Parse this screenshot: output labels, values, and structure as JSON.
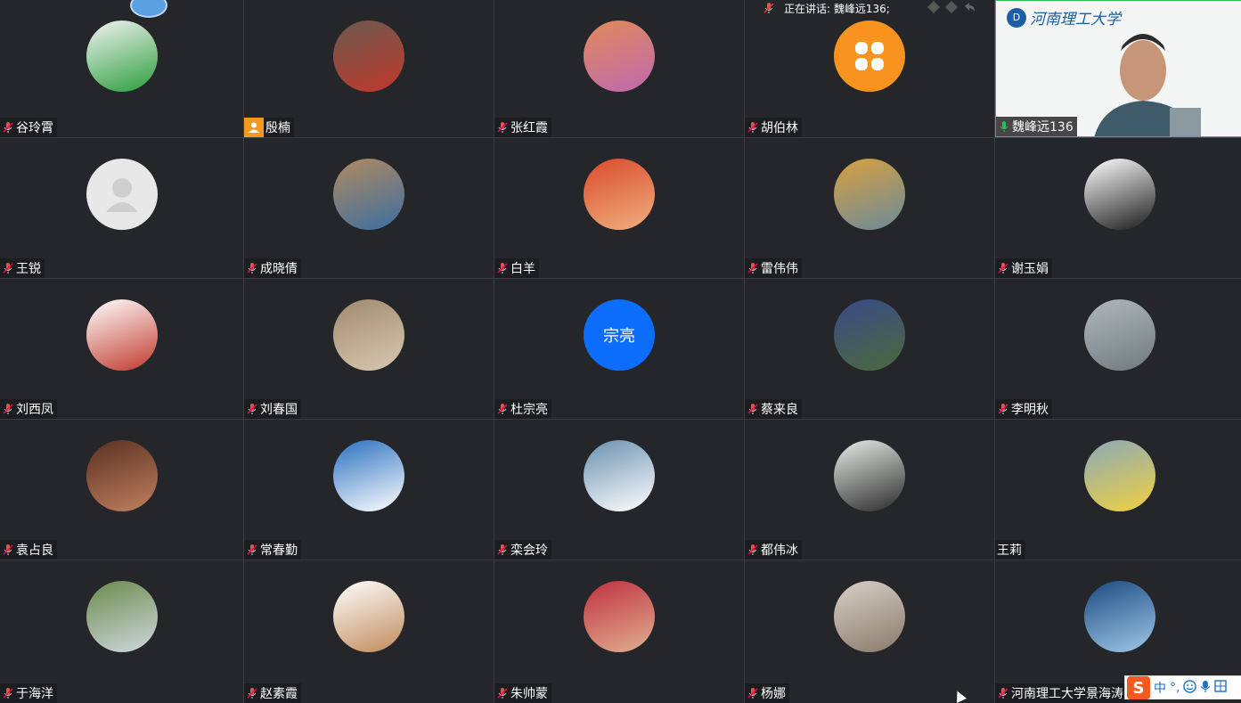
{
  "speaking": {
    "label": "正在讲话: 魏峰远136;"
  },
  "speaker": {
    "logo_text": "河南理工大学",
    "logo_mark": "D"
  },
  "ime": {
    "logo": "S",
    "mode": "中",
    "punct": "°,",
    "emoji": "☺",
    "mic": "🎤",
    "extra": "⊞"
  },
  "participants": [
    {
      "name": "谷玲霄",
      "avatar": "cartoon-girl",
      "colors": [
        "#f3f3f3",
        "#2a9d3a"
      ]
    },
    {
      "name": "殷楠",
      "avatar": "photo-boy-car",
      "colors": [
        "#6b5a50",
        "#c0392b"
      ],
      "badge": "person"
    },
    {
      "name": "张红霞",
      "avatar": "photo-sunset-flowers",
      "colors": [
        "#e08a5a",
        "#c069b0"
      ]
    },
    {
      "name": "胡伯林",
      "avatar": "orange-clover",
      "colors": [
        "#f7931e",
        "#ffffff"
      ]
    },
    {
      "name": "魏峰远136",
      "avatar": "speaker-video",
      "speaker": true
    },
    {
      "name": "王锐",
      "avatar": "default-user",
      "colors": [
        "#e8e8e8",
        "#cfcfcf"
      ]
    },
    {
      "name": "成晓倩",
      "avatar": "photo-girl-chair",
      "colors": [
        "#b08a60",
        "#3c6ea0"
      ]
    },
    {
      "name": "白羊",
      "avatar": "photo-hand-red",
      "colors": [
        "#d94a2a",
        "#f0b080"
      ]
    },
    {
      "name": "雷伟伟",
      "avatar": "photo-castle",
      "colors": [
        "#d9a040",
        "#6a8a9a"
      ]
    },
    {
      "name": "谢玉娟",
      "avatar": "drawing-girl",
      "colors": [
        "#ffffff",
        "#1a1a1a"
      ]
    },
    {
      "name": "刘西凤",
      "avatar": "toy-teapot",
      "colors": [
        "#ffffff",
        "#c0392b"
      ]
    },
    {
      "name": "刘春国",
      "avatar": "photo-rocks",
      "colors": [
        "#a08a70",
        "#d8c8b0"
      ]
    },
    {
      "name": "杜宗亮",
      "avatar": "text",
      "initials": "宗亮",
      "colors": [
        "#0d6efd",
        "#ffffff"
      ]
    },
    {
      "name": "蔡来良",
      "avatar": "photo-blue-flowers",
      "colors": [
        "#3a4a8a",
        "#4a6a3a"
      ]
    },
    {
      "name": "李明秋",
      "avatar": "photo-sea-mist",
      "colors": [
        "#b0b8bc",
        "#707a80"
      ]
    },
    {
      "name": "袁占良",
      "avatar": "photo-statue",
      "colors": [
        "#5a3020",
        "#c08060"
      ]
    },
    {
      "name": "常春勤",
      "avatar": "photo-sky-clouds",
      "colors": [
        "#2a70c0",
        "#ffffff"
      ]
    },
    {
      "name": "栾会玲",
      "avatar": "photo-daisy-vase",
      "colors": [
        "#6a90b0",
        "#ffffff"
      ]
    },
    {
      "name": "都伟冰",
      "avatar": "photo-little-girl",
      "colors": [
        "#e8ece8",
        "#2a2a2a"
      ]
    },
    {
      "name": "王莉",
      "avatar": "photo-yellow-flowers",
      "colors": [
        "#8aaab8",
        "#f0d040"
      ],
      "no_mic": true
    },
    {
      "name": "于海洋",
      "avatar": "photo-field",
      "colors": [
        "#6a8a4a",
        "#d0d8e0"
      ]
    },
    {
      "name": "赵素霞",
      "avatar": "drawing-girl-face",
      "colors": [
        "#ffffff",
        "#c08a5a"
      ]
    },
    {
      "name": "朱帅蒙",
      "avatar": "photo-beans-hand",
      "colors": [
        "#c03040",
        "#e0b090"
      ]
    },
    {
      "name": "杨娜",
      "avatar": "photo-hedgehog",
      "colors": [
        "#d8d0c8",
        "#8a7a6a"
      ]
    },
    {
      "name": "河南理工大学景海涛",
      "avatar": "photo-ocean",
      "colors": [
        "#1a4a80",
        "#a0c8e8"
      ]
    }
  ]
}
